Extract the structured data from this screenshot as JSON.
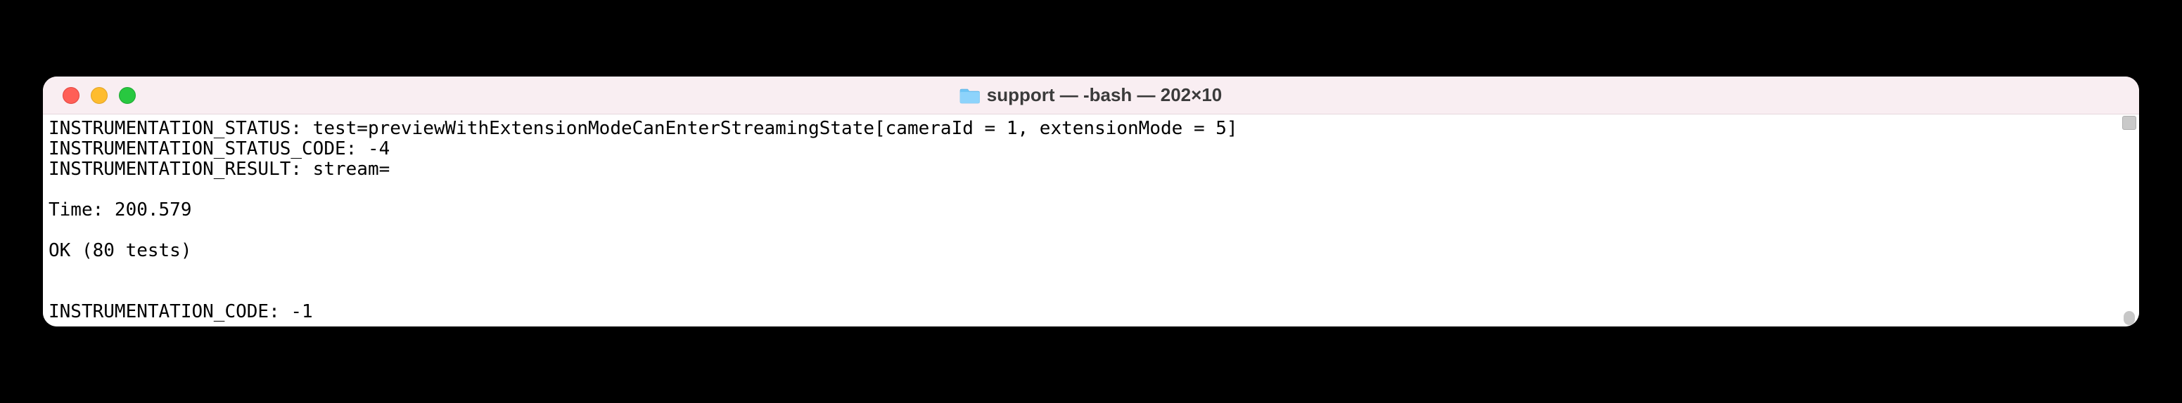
{
  "window": {
    "title": "support — -bash — 202×10"
  },
  "terminal": {
    "lines": [
      "INSTRUMENTATION_STATUS: test=previewWithExtensionModeCanEnterStreamingState[cameraId = 1, extensionMode = 5]",
      "INSTRUMENTATION_STATUS_CODE: -4",
      "INSTRUMENTATION_RESULT: stream=",
      "",
      "Time: 200.579",
      "",
      "OK (80 tests)",
      "",
      "",
      "INSTRUMENTATION_CODE: -1"
    ]
  },
  "icons": {
    "folder": "folder-icon"
  },
  "colors": {
    "titlebar_bg": "#f9eef2",
    "window_bg": "#ffffff",
    "page_bg": "#000000",
    "red": "#ff5f57",
    "yellow": "#febc2e",
    "green": "#28c840"
  }
}
